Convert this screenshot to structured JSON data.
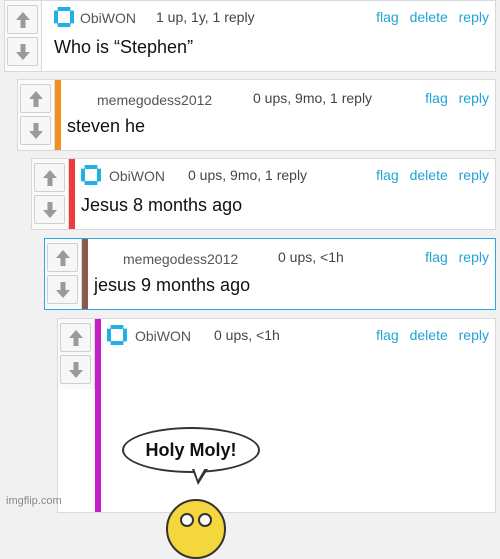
{
  "comments": [
    {
      "user": "ObiWON",
      "meta": "1 up, 1y, 1 reply",
      "body": "Who is “Stephen”",
      "actions": [
        "flag",
        "delete",
        "reply"
      ],
      "stripe_color": ""
    },
    {
      "user": "memegodess2012",
      "meta": "0 ups, 9mo, 1 reply",
      "body": "steven he",
      "actions": [
        "flag",
        "reply"
      ],
      "stripe_color": "#f5901e"
    },
    {
      "user": "ObiWON",
      "meta": "0 ups, 9mo, 1 reply",
      "body": "Jesus 8 months ago",
      "actions": [
        "flag",
        "delete",
        "reply"
      ],
      "stripe_color": "#ee3b3b"
    },
    {
      "user": "memegodess2012",
      "meta": "0 ups, <1h",
      "body": "jesus 9 months ago",
      "actions": [
        "flag",
        "reply"
      ],
      "stripe_color": "#8b5a4a"
    },
    {
      "user": "ObiWON",
      "meta": "0 ups, <1h",
      "body": "",
      "actions": [
        "flag",
        "delete",
        "reply"
      ],
      "stripe_color": "#c41fc4",
      "image_text": "Holy Moly!"
    }
  ],
  "watermark": "imgflip.com",
  "colors": {
    "link": "#1fa4d6",
    "avatar": "#1fb1e6",
    "highlight_border": "#2aa8df"
  },
  "icons": {
    "upvote": "arrow-up-icon",
    "downvote": "arrow-down-icon",
    "avatar": "user-avatar-icon"
  }
}
